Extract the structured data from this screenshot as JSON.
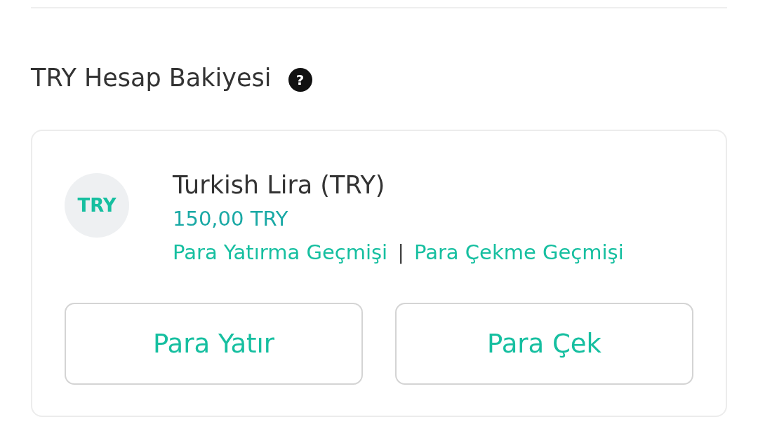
{
  "section_title": "TRY Hesap Bakiyesi",
  "help_icon": "?",
  "currency": {
    "code_badge": "TRY",
    "name": "Turkish Lira (TRY)",
    "balance": "150,00 TRY",
    "links": [
      "Para Yatırma Geçmişi",
      "Para Çekme Geçmişi"
    ],
    "separator": "|"
  },
  "buttons": [
    "Para Yatır",
    "Para Çek"
  ]
}
